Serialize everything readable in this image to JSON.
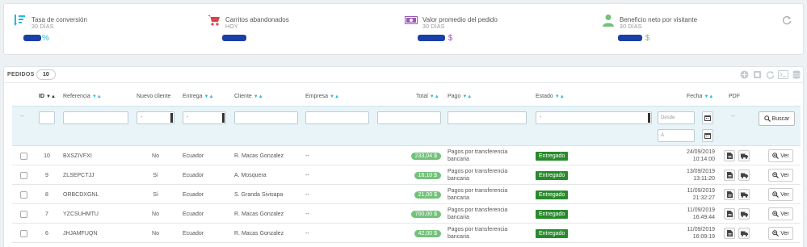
{
  "kpis": [
    {
      "title": "Tasa de conversión",
      "period": "30 DÍAS",
      "value_suffix": "%",
      "icon": "conversion-list-icon",
      "color": "#25b9d7"
    },
    {
      "title": "Carritos abandonados",
      "period": "HOY",
      "value_suffix": "",
      "icon": "cart-icon",
      "color": "#e0404c"
    },
    {
      "title": "Valor promedio del pedido",
      "period": "30 DÍAS",
      "value_suffix": "$",
      "icon": "money-icon",
      "color": "#9b59b6"
    },
    {
      "title": "Beneficio neto por visitante",
      "period": "30 DÍAS",
      "value_suffix": "$",
      "icon": "user-icon",
      "color": "#72c279"
    }
  ],
  "orders": {
    "title": "PEDIDOS",
    "count": "10",
    "columns": {
      "id": "ID",
      "referencia": "Referencia",
      "nuevo_cliente": "Nuevo cliente",
      "entrega": "Entrega",
      "cliente": "Cliente",
      "empresa": "Empresa",
      "total": "Total",
      "pago": "Pago",
      "estado": "Estado",
      "fecha": "Fecha",
      "pdf": "PDF"
    },
    "filters": {
      "select_placeholder": "-",
      "row_dash": "--",
      "pdf_dash": "--",
      "date_from": "Desde",
      "date_to": "A",
      "search_label": "Buscar"
    },
    "rows": [
      {
        "id": "10",
        "ref": "BXSZIVFXI",
        "nuevo": "No",
        "entrega": "Ecuador",
        "cliente": "R. Macas Gonzalez",
        "empresa": "--",
        "total": "233,04 $",
        "pago": "Pagos por transferencia bancaria",
        "estado": "Entregado",
        "fecha": "24/09/2019",
        "hora": "10:14:00",
        "ver": "Ver"
      },
      {
        "id": "9",
        "ref": "ZLSEPCTJJ",
        "nuevo": "Sí",
        "entrega": "Ecuador",
        "cliente": "A. Mosquera",
        "empresa": "--",
        "total": "16,10 $",
        "pago": "Pagos por transferencia bancaria",
        "estado": "Entregado",
        "fecha": "13/09/2019",
        "hora": "13:11:20",
        "ver": "Ver"
      },
      {
        "id": "8",
        "ref": "ORBCDXGNL",
        "nuevo": "Sí",
        "entrega": "Ecuador",
        "cliente": "S. Granda Sivisapa",
        "empresa": "--",
        "total": "21,00 $",
        "pago": "Pagos por transferencia bancaria",
        "estado": "Entregado",
        "fecha": "11/09/2019",
        "hora": "21:32:27",
        "ver": "Ver"
      },
      {
        "id": "7",
        "ref": "YZCSUHMTU",
        "nuevo": "No",
        "entrega": "Ecuador",
        "cliente": "R. Macas Gonzalez",
        "empresa": "--",
        "total": "700,00 $",
        "pago": "Pagos por transferencia bancaria",
        "estado": "Entregado",
        "fecha": "11/09/2019",
        "hora": "16:49:44",
        "ver": "Ver"
      },
      {
        "id": "6",
        "ref": "JHJAMFUQN",
        "nuevo": "No",
        "entrega": "Ecuador",
        "cliente": "R. Macas Gonzalez",
        "empresa": "--",
        "total": "42,00 $",
        "pago": "Pagos por transferencia bancaria",
        "estado": "Entregado",
        "fecha": "11/09/2019",
        "hora": "16:09:19",
        "ver": "Ver"
      }
    ]
  }
}
